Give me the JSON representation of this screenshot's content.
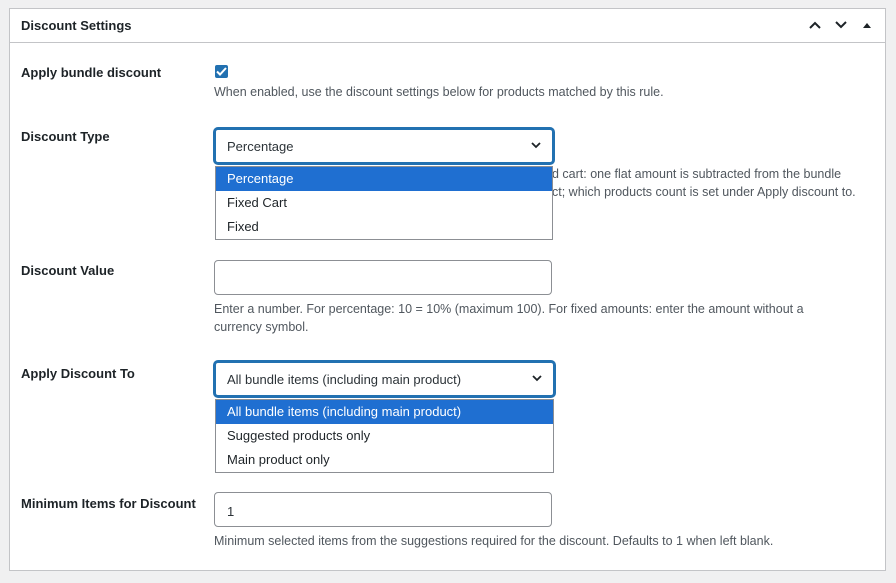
{
  "panel": {
    "title": "Discount Settings"
  },
  "apply_bundle": {
    "label": "Apply bundle discount",
    "checked": true,
    "description": "When enabled, use the discount settings below for products matched by this rule."
  },
  "discount_type": {
    "label": "Discount Type",
    "selected": "Percentage",
    "description_line1": "d cart: one flat amount is subtracted from the bundle",
    "description_line2": "ct; which products count is set under Apply discount to.",
    "options": [
      "Percentage",
      "Fixed Cart",
      "Fixed"
    ]
  },
  "discount_value": {
    "label": "Discount Value",
    "value": "",
    "description": "Enter a number. For percentage: 10 = 10% (maximum 100). For fixed amounts: enter the amount without a currency symbol."
  },
  "apply_discount_to": {
    "label": "Apply Discount To",
    "selected": "All bundle items (including main product)",
    "options": [
      "All bundle items (including main product)",
      "Suggested products only",
      "Main product only"
    ]
  },
  "minimum_items": {
    "label": "Minimum Items for Discount",
    "value": "1",
    "description": "Minimum selected items from the suggestions required for the discount. Defaults to 1 when left blank."
  },
  "colors": {
    "accent": "#2271b1",
    "dropdown_highlight": "#1f6fd1"
  },
  "icons": [
    "chevron-up-icon",
    "chevron-down-icon",
    "triangle-up-icon",
    "checkmark-icon",
    "select-chevron-icon"
  ]
}
